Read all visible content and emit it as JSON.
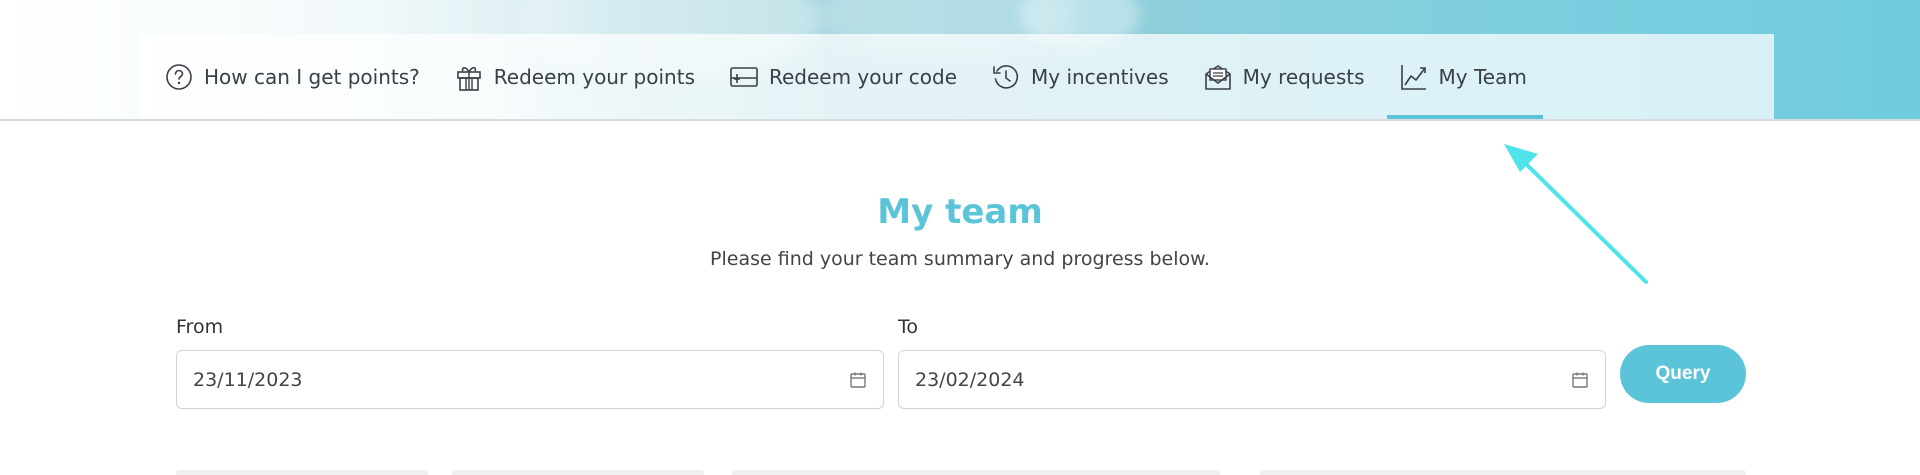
{
  "nav": {
    "items": [
      {
        "label": "How can I get points?",
        "icon": "question-circle-icon"
      },
      {
        "label": "Redeem your points",
        "icon": "gift-icon"
      },
      {
        "label": "Redeem your code",
        "icon": "ticket-icon"
      },
      {
        "label": "My incentives",
        "icon": "history-icon"
      },
      {
        "label": "My requests",
        "icon": "envelope-open-icon"
      },
      {
        "label": "My Team",
        "icon": "line-chart-icon",
        "active": true
      }
    ]
  },
  "main": {
    "title": "My team",
    "subtitle": "Please find your team summary and progress below.",
    "from": {
      "label": "From",
      "value": "23/11/2023"
    },
    "to": {
      "label": "To",
      "value": "23/02/2024"
    },
    "query_label": "Query"
  },
  "colors": {
    "accent": "#5bc4d9",
    "annotation_arrow": "#4fe3ea"
  }
}
